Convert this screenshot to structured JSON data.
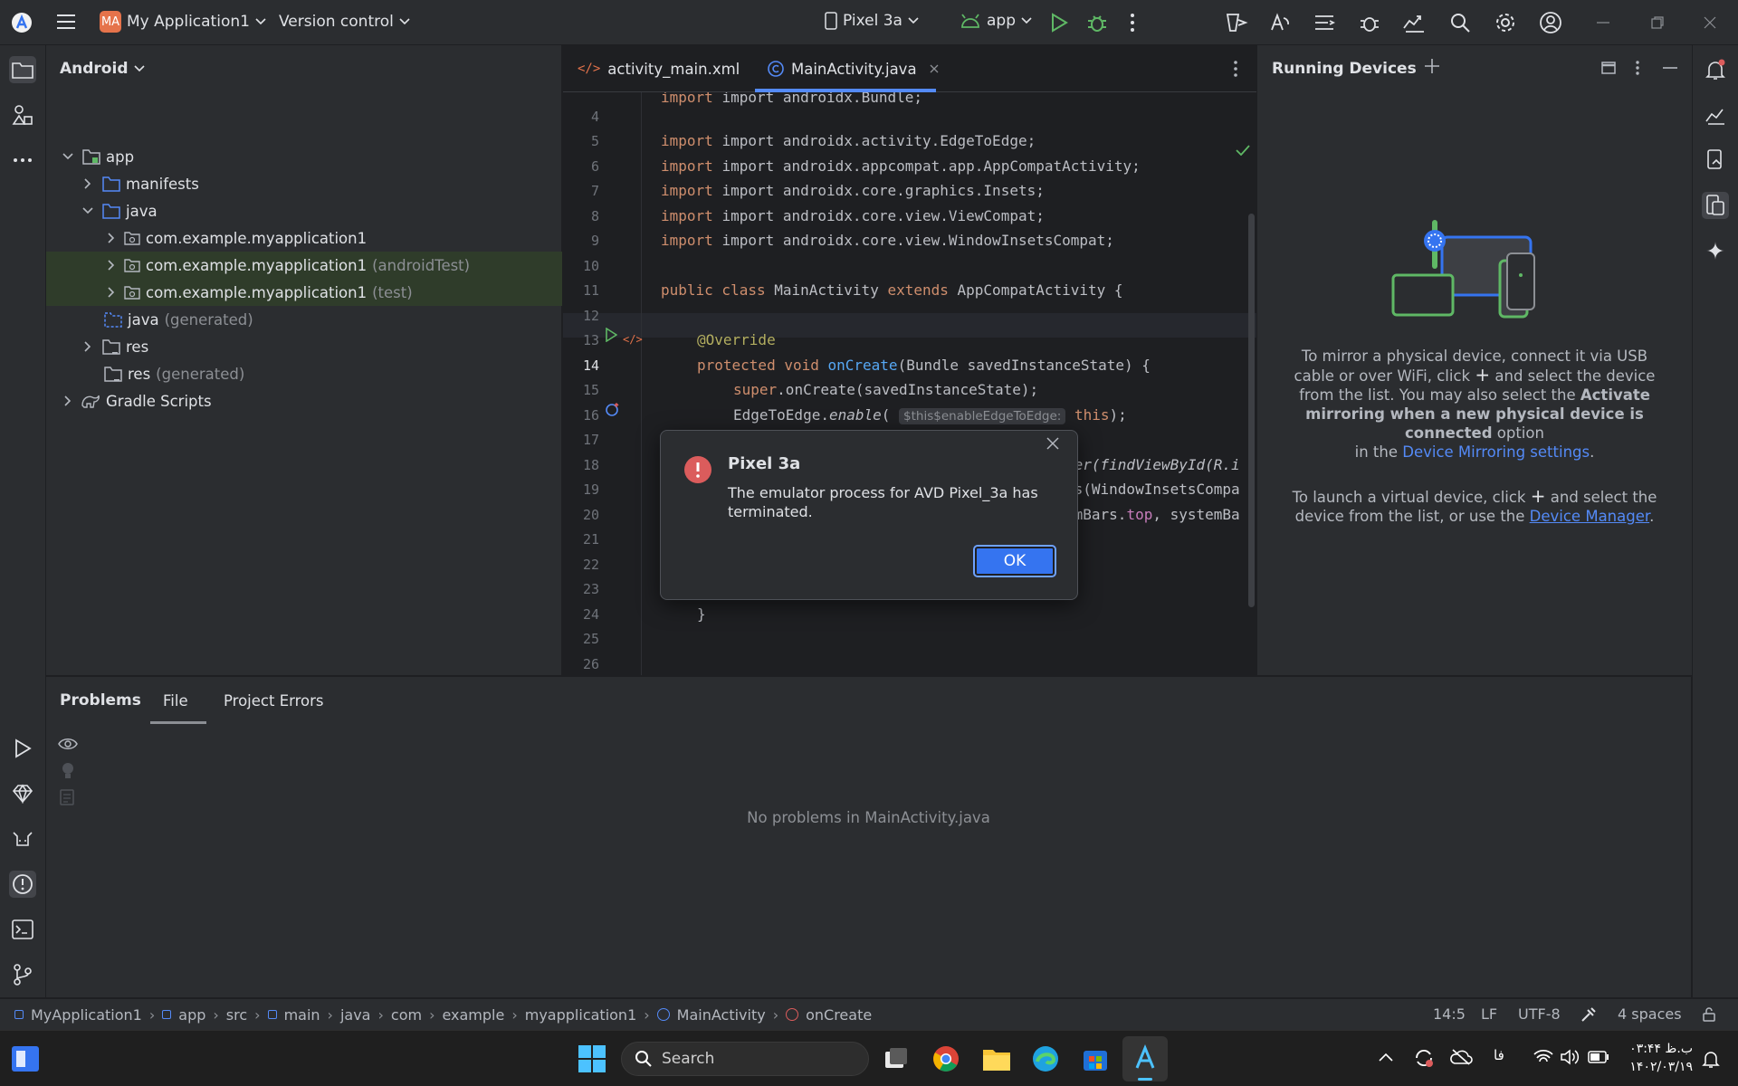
{
  "titlebar": {
    "project_badge": "MA",
    "project_name": "My Application1",
    "version_control": "Version control",
    "device": "Pixel 3a",
    "run_config": "app"
  },
  "project_pane": {
    "view_mode": "Android",
    "tree": [
      {
        "label": "app",
        "suffix": ""
      },
      {
        "label": "manifests",
        "suffix": ""
      },
      {
        "label": "java",
        "suffix": ""
      },
      {
        "label": "com.example.myapplication1",
        "suffix": ""
      },
      {
        "label": "com.example.myapplication1",
        "suffix": "(androidTest)"
      },
      {
        "label": "com.example.myapplication1",
        "suffix": "(test)"
      },
      {
        "label": "java",
        "suffix": "(generated)"
      },
      {
        "label": "res",
        "suffix": ""
      },
      {
        "label": "res",
        "suffix": "(generated)"
      },
      {
        "label": "Gradle Scripts",
        "suffix": ""
      }
    ]
  },
  "editor": {
    "tabs": [
      {
        "label": "activity_main.xml"
      },
      {
        "label": "MainActivity.java"
      }
    ],
    "line_numbers": [
      "4",
      "5",
      "6",
      "7",
      "8",
      "9",
      "10",
      "11",
      "12",
      "13",
      "14",
      "15",
      "16",
      "17",
      "18",
      "19",
      "20",
      "21",
      "22",
      "23",
      "24",
      "25",
      "26"
    ],
    "code": {
      "l3": "import androidx.Bundle;",
      "l5": "import androidx.activity.EdgeToEdge;",
      "l6": "import androidx.appcompat.app.AppCompatActivity;",
      "l7": "import androidx.core.graphics.Insets;",
      "l8": "import androidx.core.view.ViewCompat;",
      "l9": "import androidx.core.view.WindowInsetsCompat;",
      "l11_kw": "public class",
      "l11_rest": " MainActivity ",
      "l11_kw2": "extends",
      "l11_end": " AppCompatActivity {",
      "l13": "@Override",
      "l14_kw": "protected void",
      "l14_fn": "onCreate",
      "l14_rest": "(Bundle savedInstanceState) {",
      "l15_kw": "super",
      "l15_rest": ".onCreate(savedInstanceState);",
      "l16_a": "EdgeToEdge.",
      "l16_fn": "enable",
      "l16_b": "(",
      "l16_hint": "$this$enableEdgeToEdge:",
      "l16_kw": "this",
      "l16_c": ");",
      "l17": ";",
      "l18": "ner(findViewById(R.i",
      "l19": "ts(WindowInsetsCompa",
      "l20_a": "emBars.",
      "l20_fld": "top",
      "l20_b": ", systemBa",
      "l24": "}"
    }
  },
  "running_devices": {
    "title": "Running Devices",
    "p1_a": "To mirror a physical device, connect it via USB",
    "p1_b1": "cable or over WiFi, click",
    "p1_b2": "and select the device",
    "p1_c1": "from the list. You may also select the",
    "p1_c2": "Activate",
    "p1_d": "mirroring when a new physical device is",
    "p1_e1": "connected",
    "p1_e2": "option",
    "p1_f1": "in the",
    "p1_f2": "Device Mirroring settings",
    "p1_f3": ".",
    "p2_a1": "To launch a virtual device, click",
    "p2_a2": "and select the",
    "p2_b1": "device from the list, or use the",
    "p2_b2": "Device Manager",
    "p2_b3": "."
  },
  "problems": {
    "tabs": [
      "Problems",
      "File",
      "Project Errors"
    ],
    "empty_message": "No problems in MainActivity.java"
  },
  "statusbar": {
    "breadcrumbs": [
      "MyApplication1",
      "app",
      "src",
      "main",
      "java",
      "com",
      "example",
      "myapplication1",
      "MainActivity",
      "onCreate"
    ],
    "position": "14:5",
    "line_sep": "LF",
    "encoding": "UTF-8",
    "indent": "4 spaces"
  },
  "dialog": {
    "title": "Pixel 3a",
    "message_1": "The emulator process for AVD Pixel_3a has",
    "message_2": "terminated.",
    "ok": "OK"
  },
  "taskbar": {
    "search_placeholder": "Search",
    "tray_lang": "فا",
    "time": "۰۳:۴۴ ب.ظ",
    "date": "۱۴۰۲/۰۳/۱۹"
  },
  "colors": {
    "accent": "#3574f0",
    "error": "#db5c5c",
    "bg_editor": "#1e1f22",
    "bg_panel": "#2b2d30"
  }
}
